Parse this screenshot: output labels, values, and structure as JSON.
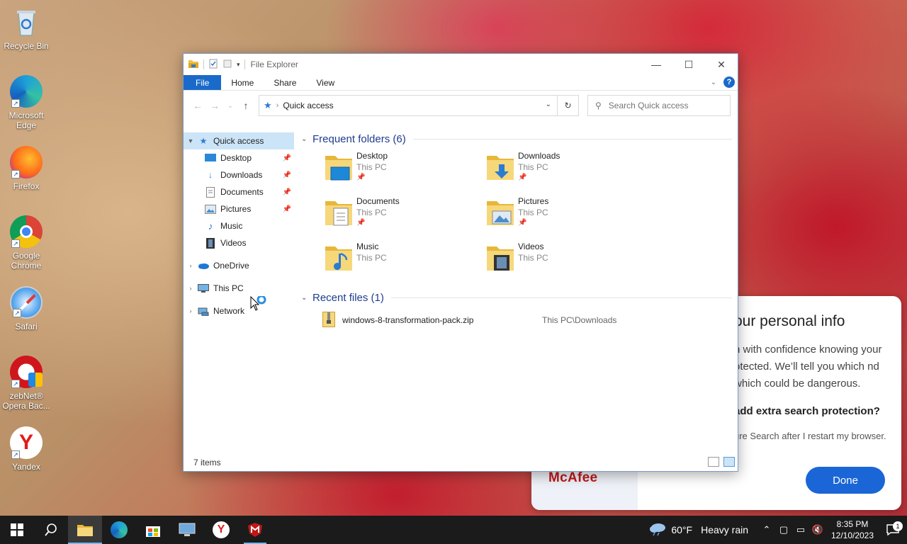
{
  "desktop": {
    "icons": [
      {
        "label": "Recycle Bin"
      },
      {
        "label": "Microsoft Edge"
      },
      {
        "label": "Firefox"
      },
      {
        "label": "Google Chrome"
      },
      {
        "label": "Safari"
      },
      {
        "label": "zebNet® Opera Bac..."
      },
      {
        "label": "Yandex"
      }
    ]
  },
  "mcafee": {
    "title": "our personal info",
    "body": "h with confidence knowing your otected. We’ll tell you which nd which could be dangerous.",
    "question": "add extra search protection?",
    "checkbox_text": "ure Search after I restart my browser.",
    "logo": "McAfee",
    "done_label": "Done",
    "brand_color": "#c01818",
    "button_color": "#1a66d6"
  },
  "explorer": {
    "title": "File Explorer",
    "tabs": [
      {
        "label": "File"
      },
      {
        "label": "Home"
      },
      {
        "label": "Share"
      },
      {
        "label": "View"
      }
    ],
    "address": "Quick access",
    "search_placeholder": "Search Quick access",
    "nav": {
      "quick_access": "Quick access",
      "quick_items": [
        {
          "label": "Desktop",
          "pinned": true
        },
        {
          "label": "Downloads",
          "pinned": true
        },
        {
          "label": "Documents",
          "pinned": true
        },
        {
          "label": "Pictures",
          "pinned": true
        },
        {
          "label": "Music",
          "pinned": false
        },
        {
          "label": "Videos",
          "pinned": false
        }
      ],
      "onedrive": "OneDrive",
      "this_pc": "This PC",
      "network": "Network"
    },
    "frequent_header": "Frequent folders (6)",
    "folders": [
      {
        "name": "Desktop",
        "location": "This PC",
        "pinned": true
      },
      {
        "name": "Downloads",
        "location": "This PC",
        "pinned": true
      },
      {
        "name": "Documents",
        "location": "This PC",
        "pinned": true
      },
      {
        "name": "Pictures",
        "location": "This PC",
        "pinned": true
      },
      {
        "name": "Music",
        "location": "This PC",
        "pinned": false
      },
      {
        "name": "Videos",
        "location": "This PC",
        "pinned": false
      }
    ],
    "recent_header": "Recent files (1)",
    "recent_files": [
      {
        "name": "windows-8-transformation-pack.zip",
        "path": "This PC\\Downloads"
      }
    ],
    "status": "7 items",
    "accent_color": "#1a6ac9"
  },
  "taskbar": {
    "weather_temp": "60°F",
    "weather_text": "Heavy rain",
    "time": "8:35 PM",
    "date": "12/10/2023",
    "notification_count": "1"
  }
}
